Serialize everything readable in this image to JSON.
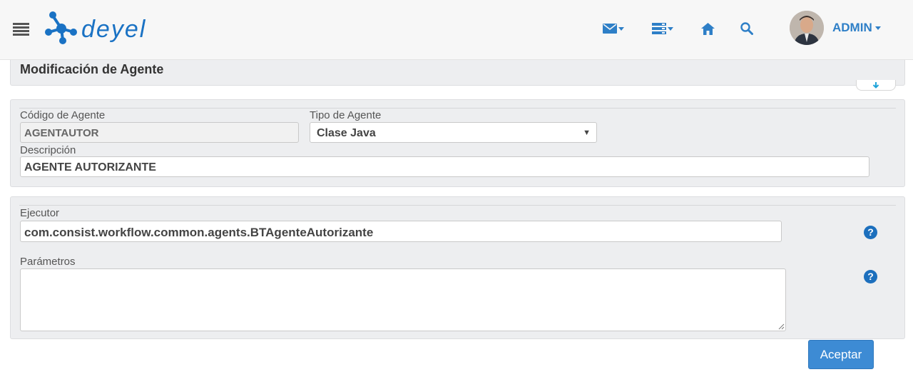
{
  "header": {
    "brand": "deyel",
    "user_name": "ADMIN",
    "icons": [
      "menu-icon",
      "envelope-icon",
      "server-icon",
      "home-icon",
      "search-icon"
    ],
    "accent_color": "#2e7fc7"
  },
  "page": {
    "title": "Modificación de Agente"
  },
  "form": {
    "codigo_label": "Código de Agente",
    "codigo_value": "AGENTAUTOR",
    "tipo_label": "Tipo de Agente",
    "tipo_value": "Clase Java",
    "descripcion_label": "Descripción",
    "descripcion_value": "AGENTE AUTORIZANTE",
    "ejecutor_label": "Ejecutor",
    "ejecutor_value": "com.consist.workflow.common.agents.BTAgenteAutorizante",
    "parametros_label": "Parámetros",
    "parametros_value": ""
  },
  "actions": {
    "accept_label": "Aceptar"
  }
}
